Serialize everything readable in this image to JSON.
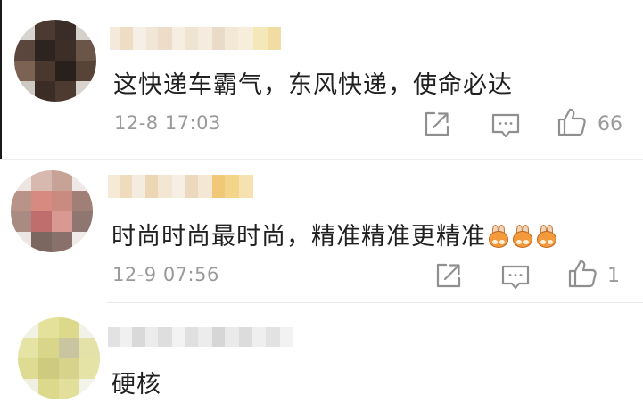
{
  "comments": [
    {
      "text": "这快递车霸气，东风快递，使命必达",
      "time": "12-8 17:03",
      "likes": "66",
      "reactions": []
    },
    {
      "text": "时尚时尚最时尚，精准精准更精准",
      "time": "12-9 07:56",
      "likes": "1",
      "reactions": [
        "rabbit-clap-emoji",
        "rabbit-clap-emoji",
        "rabbit-clap-emoji"
      ]
    },
    {
      "text": "硬核",
      "time": "",
      "likes": "",
      "reactions": []
    }
  ],
  "icons": {
    "share": "share-icon",
    "reply": "comment-icon",
    "like": "thumbs-up-icon"
  },
  "colors": {
    "text": "#202020",
    "meta": "#9a9a9a",
    "reaction": "#f29a3c"
  }
}
